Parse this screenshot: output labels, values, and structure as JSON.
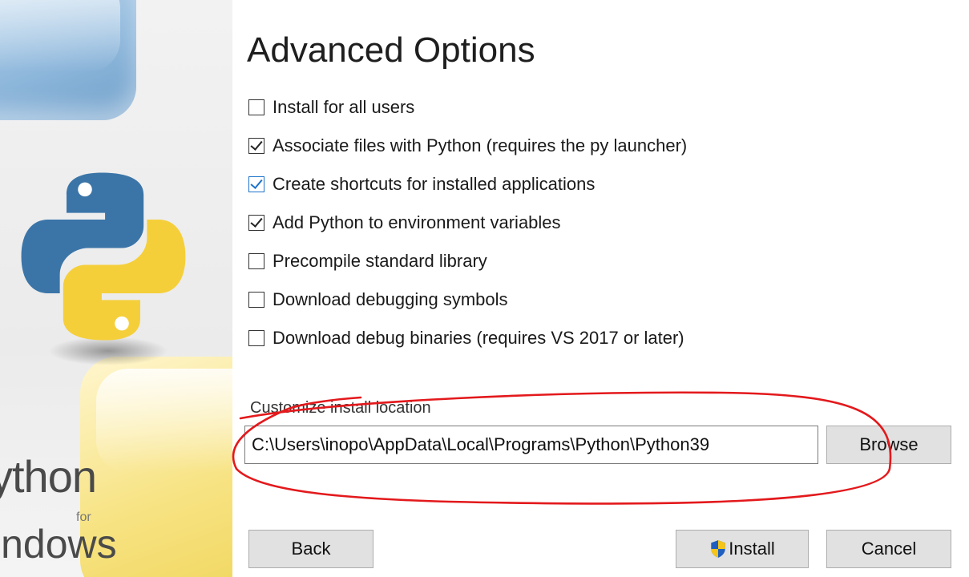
{
  "side_panel": {
    "brand_python": "ython",
    "brand_for": "for",
    "brand_windows": "indows",
    "logo_colors": {
      "blue": "#3b75a8",
      "yellow": "#f5cf3a"
    }
  },
  "title": "Advanced Options",
  "options": [
    {
      "label": "Install for all users",
      "checked": false,
      "focused": false
    },
    {
      "label": "Associate files with Python (requires the py launcher)",
      "checked": true,
      "focused": false
    },
    {
      "label": "Create shortcuts for installed applications",
      "checked": true,
      "focused": true
    },
    {
      "label": "Add Python to environment variables",
      "checked": true,
      "focused": false
    },
    {
      "label": "Precompile standard library",
      "checked": false,
      "focused": false
    },
    {
      "label": "Download debugging symbols",
      "checked": false,
      "focused": false
    },
    {
      "label": "Download debug binaries (requires VS 2017 or later)",
      "checked": false,
      "focused": false
    }
  ],
  "install_location": {
    "label": "Customize install location",
    "value": "C:\\Users\\inopo\\AppData\\Local\\Programs\\Python\\Python39",
    "browse_label": "Browse"
  },
  "footer": {
    "back_label": "Back",
    "install_label": "Install",
    "cancel_label": "Cancel"
  },
  "colors": {
    "annotation": "#e3191c",
    "focus_blue": "#1e73c9",
    "button_bg": "#e1e1e1"
  },
  "icons": {
    "install_button_icon": "uac-shield-icon"
  }
}
